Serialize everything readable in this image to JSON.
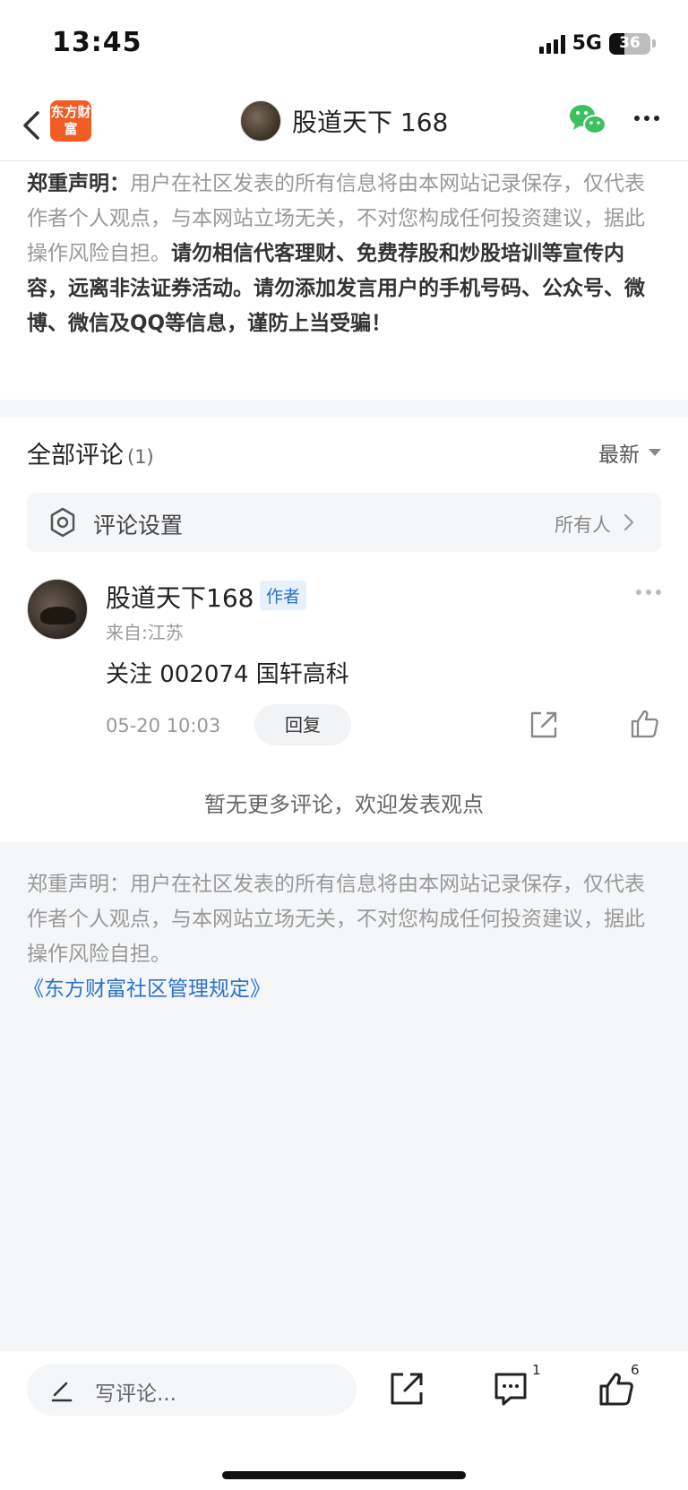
{
  "status": {
    "time": "13:45",
    "network": "5G",
    "battery": "36",
    "battery_level": 0.36
  },
  "nav": {
    "app_logo_text": "东方财富",
    "title": "股道天下 168"
  },
  "disclaimer_top": {
    "prefix": "郑重声明：",
    "normal": "用户在社区发表的所有信息将由本网站记录保存，仅代表作者个人观点，与本网站立场无关，不对您构成任何投资建议，据此操作风险自担。",
    "bold": "请勿相信代客理财、免费荐股和炒股培训等宣传内容，远离非法证券活动。请勿添加发言用户的手机号码、公众号、微博、微信及QQ等信息，谨防上当受骗！"
  },
  "comments": {
    "title": "全部评论",
    "count": "(1)",
    "sort_label": "最新",
    "settings_label": "评论设置",
    "settings_value": "所有人",
    "no_more": "暂无更多评论，欢迎发表观点",
    "items": [
      {
        "author": "股道天下168",
        "tag": "作者",
        "from": "来自:江苏",
        "text": "关注 002074 国轩高科",
        "time": "05-20 10:03",
        "reply_label": "回复"
      }
    ]
  },
  "disclaimer_bottom": {
    "text": "郑重声明：用户在社区发表的所有信息将由本网站记录保存，仅代表作者个人观点，与本网站立场无关，不对您构成任何投资建议，据此操作风险自担。",
    "rules_link": "《东方财富社区管理规定》"
  },
  "bottom_bar": {
    "write_placeholder": "写评论...",
    "comment_count": "1",
    "like_count": "6"
  },
  "colors": {
    "brand": "#f25c25",
    "link": "#2d73c9",
    "wechat": "#3dc160"
  }
}
